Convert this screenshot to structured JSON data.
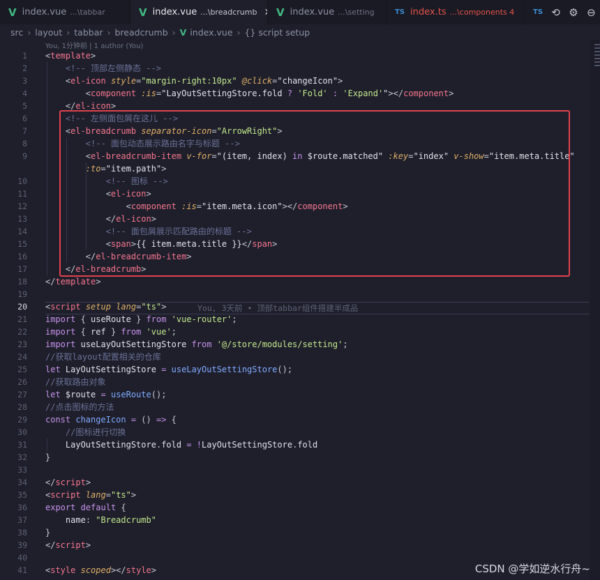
{
  "tabs": [
    {
      "name": "index.vue",
      "desc": "...\\tabbar",
      "active": false
    },
    {
      "name": "index.vue",
      "desc": "...\\breadcrumb",
      "active": true
    },
    {
      "name": "index.vue",
      "desc": "...\\setting",
      "active": false
    },
    {
      "name": "index.ts",
      "desc": "...\\components 4",
      "active": false,
      "error": true
    },
    {
      "name": "TS",
      "desc": "",
      "active": false
    }
  ],
  "breadcrumb": {
    "items": [
      "src",
      "layout",
      "tabbar",
      "breadcrumb",
      "index.vue",
      "{} script setup"
    ]
  },
  "blame": {
    "header": "You, 1分钟前 | 1 author (You)",
    "inline": "You, 3天前 • 顶部tabbar组件搭建半成品"
  },
  "editor": {
    "current_line": 20,
    "lines": [
      {
        "n": "1",
        "tokens": [
          [
            "p",
            "<"
          ],
          [
            "t",
            "template"
          ],
          [
            "p",
            ">"
          ]
        ]
      },
      {
        "n": "2",
        "tokens": [
          [
            "p",
            "    "
          ],
          [
            "c",
            "<!-- 顶部左侧静态 -->"
          ]
        ]
      },
      {
        "n": "3",
        "tokens": [
          [
            "p",
            "    <"
          ],
          [
            "t",
            "el-icon"
          ],
          [
            "p",
            " "
          ],
          [
            "a",
            "style"
          ],
          [
            "p",
            "="
          ],
          [
            "s",
            "\"margin-right:10px\""
          ],
          [
            "p",
            " "
          ],
          [
            "a",
            "@click"
          ],
          [
            "p",
            "="
          ],
          [
            "v",
            "\"changeIcon\""
          ],
          [
            "p",
            ">"
          ]
        ]
      },
      {
        "n": "4",
        "tokens": [
          [
            "p",
            "        <"
          ],
          [
            "t",
            "component"
          ],
          [
            "p",
            " "
          ],
          [
            "a",
            ":is"
          ],
          [
            "p",
            "="
          ],
          [
            "v",
            "\"LayOutSettingStore.fold "
          ],
          [
            "k",
            "?"
          ],
          [
            "v",
            " "
          ],
          [
            "s",
            "'Fold'"
          ],
          [
            "v",
            " "
          ],
          [
            "k",
            ":"
          ],
          [
            "v",
            " "
          ],
          [
            "s",
            "'Expand'"
          ],
          [
            "v",
            "\""
          ],
          [
            "p",
            "></"
          ],
          [
            "t",
            "component"
          ],
          [
            "p",
            ">"
          ]
        ]
      },
      {
        "n": "5",
        "tokens": [
          [
            "p",
            "    </"
          ],
          [
            "t",
            "el-icon"
          ],
          [
            "p",
            ">"
          ]
        ]
      },
      {
        "n": "6",
        "tokens": [
          [
            "p",
            "    "
          ],
          [
            "c",
            "<!-- 左侧面包屑在这儿 -->"
          ]
        ]
      },
      {
        "n": "7",
        "tokens": [
          [
            "p",
            "    <"
          ],
          [
            "t",
            "el-breadcrumb"
          ],
          [
            "p",
            " "
          ],
          [
            "a",
            "separator-icon"
          ],
          [
            "p",
            "="
          ],
          [
            "s",
            "\"ArrowRight\""
          ],
          [
            "p",
            ">"
          ]
        ]
      },
      {
        "n": "8",
        "tokens": [
          [
            "p",
            "        "
          ],
          [
            "c",
            "<!-- 面包动态展示路由名字与标题 -->"
          ]
        ]
      },
      {
        "n": "9",
        "tokens": [
          [
            "p",
            "        <"
          ],
          [
            "t",
            "el-breadcrumb-item"
          ],
          [
            "p",
            " "
          ],
          [
            "a",
            "v-for"
          ],
          [
            "p",
            "="
          ],
          [
            "v",
            "\"(item, index) "
          ],
          [
            "k",
            "in"
          ],
          [
            "v",
            " $route.matched\""
          ],
          [
            "p",
            " "
          ],
          [
            "a",
            ":key"
          ],
          [
            "p",
            "="
          ],
          [
            "v",
            "\"index\""
          ],
          [
            "p",
            " "
          ],
          [
            "a",
            "v-show"
          ],
          [
            "p",
            "="
          ],
          [
            "v",
            "\"item.meta.title\""
          ]
        ]
      },
      {
        "n": "",
        "tokens": [
          [
            "p",
            "        "
          ],
          [
            "a",
            ":to"
          ],
          [
            "p",
            "="
          ],
          [
            "v",
            "\"item.path\""
          ],
          [
            "p",
            ">"
          ]
        ]
      },
      {
        "n": "10",
        "tokens": [
          [
            "p",
            "            "
          ],
          [
            "c",
            "<!-- 图标 -->"
          ]
        ]
      },
      {
        "n": "11",
        "tokens": [
          [
            "p",
            "            <"
          ],
          [
            "t",
            "el-icon"
          ],
          [
            "p",
            ">"
          ]
        ]
      },
      {
        "n": "12",
        "tokens": [
          [
            "p",
            "                <"
          ],
          [
            "t",
            "component"
          ],
          [
            "p",
            " "
          ],
          [
            "a",
            ":is"
          ],
          [
            "p",
            "="
          ],
          [
            "v",
            "\"item.meta.icon\""
          ],
          [
            "p",
            "></"
          ],
          [
            "t",
            "component"
          ],
          [
            "p",
            ">"
          ]
        ]
      },
      {
        "n": "13",
        "tokens": [
          [
            "p",
            "            </"
          ],
          [
            "t",
            "el-icon"
          ],
          [
            "p",
            ">"
          ]
        ]
      },
      {
        "n": "14",
        "tokens": [
          [
            "p",
            "            "
          ],
          [
            "c",
            "<!-- 面包屑展示匹配路由的标题 -->"
          ]
        ]
      },
      {
        "n": "15",
        "tokens": [
          [
            "p",
            "            <"
          ],
          [
            "t",
            "span"
          ],
          [
            "p",
            ">"
          ],
          [
            "v",
            "{{ item.meta.title }}"
          ],
          [
            "p",
            "</"
          ],
          [
            "t",
            "span"
          ],
          [
            "p",
            ">"
          ]
        ]
      },
      {
        "n": "16",
        "tokens": [
          [
            "p",
            "        </"
          ],
          [
            "t",
            "el-breadcrumb-item"
          ],
          [
            "p",
            ">"
          ]
        ]
      },
      {
        "n": "17",
        "tokens": [
          [
            "p",
            "    </"
          ],
          [
            "t",
            "el-breadcrumb"
          ],
          [
            "p",
            ">"
          ]
        ]
      },
      {
        "n": "18",
        "tokens": [
          [
            "p",
            "</"
          ],
          [
            "t",
            "template"
          ],
          [
            "p",
            ">"
          ]
        ]
      },
      {
        "n": "19",
        "tokens": []
      },
      {
        "n": "20",
        "tokens": [
          [
            "p",
            "<"
          ],
          [
            "t",
            "script"
          ],
          [
            "p",
            " "
          ],
          [
            "a",
            "setup"
          ],
          [
            "p",
            " "
          ],
          [
            "a",
            "lang"
          ],
          [
            "p",
            "="
          ],
          [
            "s",
            "\"ts\""
          ],
          [
            "p",
            ">"
          ]
        ]
      },
      {
        "n": "21",
        "tokens": [
          [
            "k",
            "import"
          ],
          [
            "p",
            " { "
          ],
          [
            "v",
            "useRoute"
          ],
          [
            "p",
            " } "
          ],
          [
            "k",
            "from"
          ],
          [
            "p",
            " "
          ],
          [
            "s",
            "'vue-router'"
          ],
          [
            "p",
            ";"
          ]
        ]
      },
      {
        "n": "22",
        "tokens": [
          [
            "k",
            "import"
          ],
          [
            "p",
            " { "
          ],
          [
            "v",
            "ref"
          ],
          [
            "p",
            " } "
          ],
          [
            "k",
            "from"
          ],
          [
            "p",
            " "
          ],
          [
            "s",
            "'vue'"
          ],
          [
            "p",
            ";"
          ]
        ]
      },
      {
        "n": "23",
        "tokens": [
          [
            "k",
            "import"
          ],
          [
            "p",
            " "
          ],
          [
            "v",
            "useLayOutSettingStore"
          ],
          [
            "p",
            " "
          ],
          [
            "k",
            "from"
          ],
          [
            "p",
            " "
          ],
          [
            "s",
            "'@/store/modules/setting'"
          ],
          [
            "p",
            ";"
          ]
        ]
      },
      {
        "n": "24",
        "tokens": [
          [
            "c",
            "//获取layout配置相关的仓库"
          ]
        ]
      },
      {
        "n": "25",
        "tokens": [
          [
            "k",
            "let"
          ],
          [
            "p",
            " "
          ],
          [
            "v",
            "LayOutSettingStore"
          ],
          [
            "p",
            " "
          ],
          [
            "k",
            "="
          ],
          [
            "p",
            " "
          ],
          [
            "f",
            "useLayOutSettingStore"
          ],
          [
            "p",
            "();"
          ]
        ]
      },
      {
        "n": "26",
        "tokens": [
          [
            "c",
            "//获取路由对象"
          ]
        ]
      },
      {
        "n": "27",
        "tokens": [
          [
            "k",
            "let"
          ],
          [
            "p",
            " "
          ],
          [
            "v",
            "$route"
          ],
          [
            "p",
            " "
          ],
          [
            "k",
            "="
          ],
          [
            "p",
            " "
          ],
          [
            "f",
            "useRoute"
          ],
          [
            "p",
            "();"
          ]
        ]
      },
      {
        "n": "28",
        "tokens": [
          [
            "c",
            "//点击图标的方法"
          ]
        ]
      },
      {
        "n": "29",
        "tokens": [
          [
            "k",
            "const"
          ],
          [
            "p",
            " "
          ],
          [
            "f",
            "changeIcon"
          ],
          [
            "p",
            " "
          ],
          [
            "k",
            "="
          ],
          [
            "p",
            " () "
          ],
          [
            "k",
            "=>"
          ],
          [
            "p",
            " {"
          ]
        ]
      },
      {
        "n": "30",
        "tokens": [
          [
            "p",
            "    "
          ],
          [
            "c",
            "//图标进行切换"
          ]
        ]
      },
      {
        "n": "31",
        "tokens": [
          [
            "p",
            "    "
          ],
          [
            "v",
            "LayOutSettingStore"
          ],
          [
            "p",
            "."
          ],
          [
            "v",
            "fold"
          ],
          [
            "p",
            " "
          ],
          [
            "k",
            "="
          ],
          [
            "p",
            " "
          ],
          [
            "k",
            "!"
          ],
          [
            "v",
            "LayOutSettingStore"
          ],
          [
            "p",
            "."
          ],
          [
            "v",
            "fold"
          ]
        ]
      },
      {
        "n": "32",
        "tokens": [
          [
            "p",
            "}"
          ]
        ]
      },
      {
        "n": "33",
        "tokens": []
      },
      {
        "n": "34",
        "tokens": [
          [
            "p",
            "</"
          ],
          [
            "t",
            "script"
          ],
          [
            "p",
            ">"
          ]
        ]
      },
      {
        "n": "35",
        "tokens": [
          [
            "p",
            "<"
          ],
          [
            "t",
            "script"
          ],
          [
            "p",
            " "
          ],
          [
            "a",
            "lang"
          ],
          [
            "p",
            "="
          ],
          [
            "s",
            "\"ts\""
          ],
          [
            "p",
            ">"
          ]
        ]
      },
      {
        "n": "36",
        "tokens": [
          [
            "k",
            "export"
          ],
          [
            "p",
            " "
          ],
          [
            "k",
            "default"
          ],
          [
            "p",
            " {"
          ]
        ]
      },
      {
        "n": "37",
        "tokens": [
          [
            "p",
            "    "
          ],
          [
            "v",
            "name"
          ],
          [
            "p",
            ": "
          ],
          [
            "s",
            "\"Breadcrumb\""
          ]
        ]
      },
      {
        "n": "38",
        "tokens": [
          [
            "p",
            "}"
          ]
        ]
      },
      {
        "n": "39",
        "tokens": [
          [
            "p",
            "</"
          ],
          [
            "t",
            "script"
          ],
          [
            "p",
            ">"
          ]
        ]
      },
      {
        "n": "40",
        "tokens": []
      },
      {
        "n": "41",
        "tokens": [
          [
            "p",
            "<"
          ],
          [
            "t",
            "style"
          ],
          [
            "p",
            " "
          ],
          [
            "a",
            "scoped"
          ],
          [
            "p",
            "></"
          ],
          [
            "t",
            "style"
          ],
          [
            "p",
            ">"
          ]
        ]
      }
    ]
  },
  "colors": {
    "background": "#1e1f2b",
    "highlight_box": "#e0424e",
    "vue_icon": "#41b883",
    "ts_icon": "#3b8fd6"
  },
  "watermark": "CSDN @学如逆水行舟~"
}
